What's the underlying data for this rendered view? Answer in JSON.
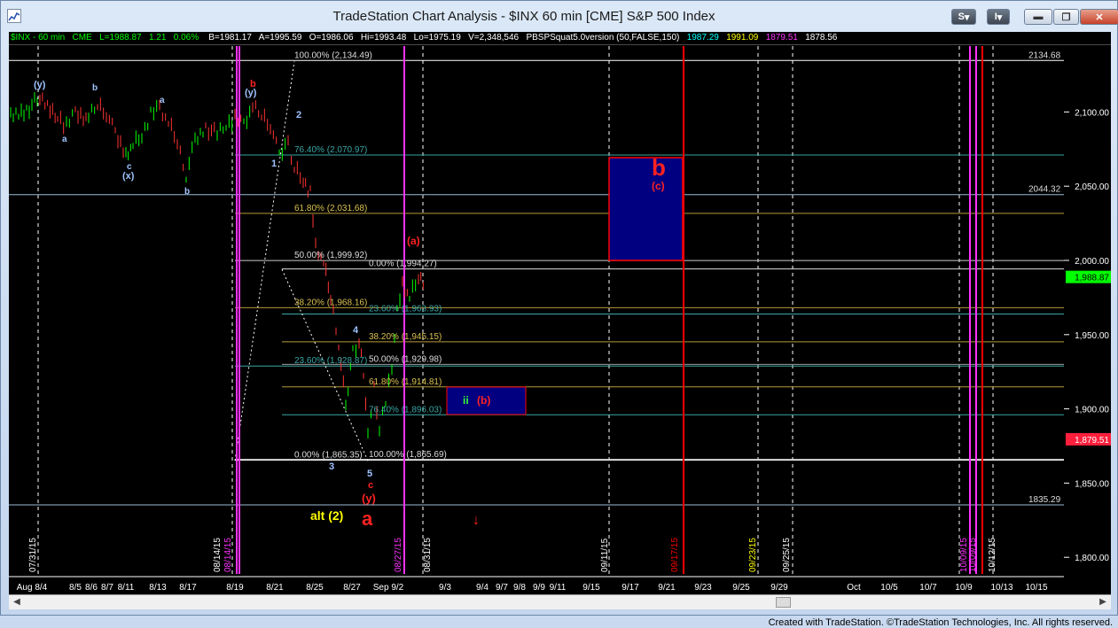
{
  "window": {
    "title": "TradeStation Chart Analysis - $INX 60 min [CME] S&P 500 Index",
    "btn_s": "S",
    "btn_i": "I",
    "minimize": "minimize",
    "restore": "restore",
    "close": "close"
  },
  "infobar": {
    "symbol": "$INX - 60 min",
    "exchange": "CME",
    "last": "L=1988.87",
    "change": "1.21",
    "pct": "0.06%",
    "bid": "B=1981.17",
    "ask": "A=1995.59",
    "open": "O=1986.06",
    "high": "Hi=1993.48",
    "low": "Lo=1975.19",
    "volume": "V=2,348,546",
    "indicator": "PBSPSquat5.0version (50,FALSE,150)",
    "ind_v1": "1987.29",
    "ind_v2": "1991.09",
    "ind_v3": "1879.51",
    "ind_v4": "1878.56"
  },
  "colors": {
    "up": "#00ff00",
    "down": "#ff3333",
    "text": "#ffffff",
    "cyan": "#00ffff",
    "yellow": "#ffff00",
    "magenta": "#ff33ff"
  },
  "chart_data": {
    "type": "bar",
    "title": "",
    "xlabel": "",
    "ylabel": "",
    "ylim": [
      1785,
      2150
    ],
    "y_ticks": [
      "2,100.00",
      "2,050.00",
      "2,000.00",
      "1,950.00",
      "1,900.00",
      "1,850.00",
      "1,800.00"
    ],
    "x_ticks": [
      "Aug 8/4",
      "8/5",
      "8/6",
      "8/7",
      "8/11",
      "8/13",
      "8/17",
      "8/19",
      "8/21",
      "8/25",
      "8/27",
      "Sep 9/2",
      "9/3",
      "9/4",
      "9/7",
      "9/8",
      "9/9",
      "9/11",
      "9/15",
      "9/17",
      "9/21",
      "9/23",
      "9/25",
      "9/29",
      "Oct",
      "10/5",
      "10/7",
      "10/9",
      "10/13",
      "10/15"
    ],
    "date_markers": [
      "07/31/15",
      "08/14/15",
      "08/14/15",
      "08/27/15",
      "08/31/15",
      "09/11/15",
      "09/17/15",
      "09/23/15",
      "09/25/15",
      "10/09/15",
      "10/09/15",
      "10/12/15"
    ],
    "price_labels": [
      "2134.68",
      "2044.32",
      "1835.29"
    ],
    "last_price": "1,988.87",
    "marker_price": "1,879.51",
    "fib_levels": [
      "100.00% (2,134.49)",
      "76.40% (2,070.97)",
      "61.80% (2,031.68)",
      "50.00% (1,999.92)",
      "38.20% (1,968.16)",
      "23.60% (1,928.87)",
      "0.00% (1,865.35)",
      "0.00% (1,994.27)",
      "23.60% (1,963.93)",
      "38.20% (1,945.15)",
      "50.00% (1,929.98)",
      "61.80% (1,914.81)",
      "76.40% (1,896.03)",
      "100.00% (1,865.69)"
    ],
    "wave_labels": [
      "(y)",
      "b",
      "a",
      "c",
      "(x)",
      "b",
      "a",
      "b",
      "(y)",
      "2",
      "1",
      "3",
      "4",
      "5",
      "c",
      "(y)",
      "a",
      "(a)",
      "alt (2)",
      "b",
      "(c)",
      "ii",
      "(b)"
    ]
  },
  "footer": "Created with TradeStation. ©TradeStation Technologies, Inc. All rights reserved."
}
